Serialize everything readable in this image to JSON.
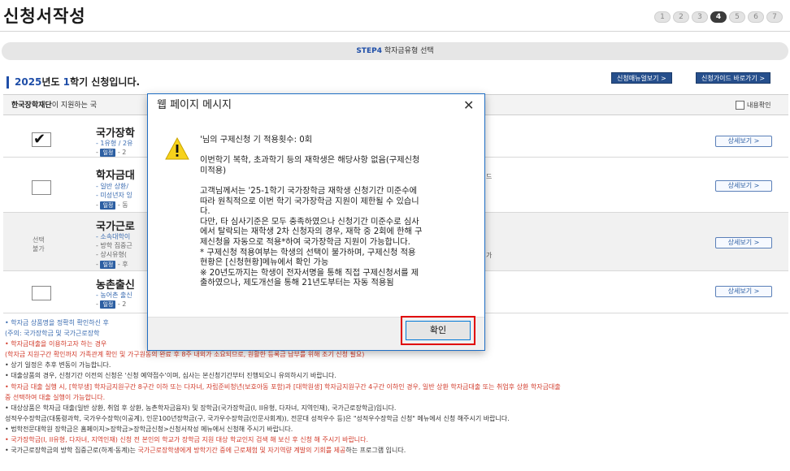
{
  "header": {
    "title": "신청서작성",
    "steps": [
      "1",
      "2",
      "3",
      "4",
      "5",
      "6",
      "7"
    ],
    "active_step": "4"
  },
  "step_bar": {
    "step": "STEP4",
    "text": " 학자금유형 선택"
  },
  "semester": {
    "year": "2025",
    "suffix": "년도 ",
    "term": "1",
    "rest": "학기 신청입니다."
  },
  "buttons": {
    "manual": "신청매뉴얼보기 >",
    "guide": "신청가이드 바로가기 >"
  },
  "notice": {
    "bold": "한국장학재단",
    "text": "이 지원하는 국",
    "confirm": "내용확인"
  },
  "products": [
    {
      "title": "국가장학",
      "sub1": "- 1유형 / 2유",
      "tag": "일정",
      "sub2": "- 2",
      "state": "checked",
      "detail": "상세보기 >"
    },
    {
      "title": "학자금대",
      "sub1": "- 일반 상환/",
      "sub2": "- 미성년자 잉",
      "tag": "일정",
      "sub3": "- 동",
      "state": "empty",
      "detail": "상세보기 >",
      "cut": "드"
    },
    {
      "title": "국가근로",
      "sub1": "- 소속대학이",
      "sub2": "- 방학 집중근",
      "sub3": "- 상시유형(",
      "tag": "일정",
      "sub4": "- 후",
      "state": "disabled",
      "disabled_label_1": "선택",
      "disabled_label_2": "불가",
      "detail": "상세보기 >",
      "cut": "가"
    },
    {
      "title": "농촌출신",
      "sub1": "- 농어촌 출신",
      "tag": "일정",
      "sub2": "- 2",
      "state": "empty",
      "detail": "상세보기 >"
    }
  ],
  "notes": [
    {
      "cls": "b",
      "text": "• 학자금 상품명을 정확히 확인하신 후"
    },
    {
      "cls": "b",
      "text": "  (주의: 국가장학금 및 국가근로장학"
    },
    {
      "cls": "r",
      "text": "• 학자금대출을 이용하고자 하는 경우"
    },
    {
      "cls": "r",
      "text": "  (학자금 지원구간 확인까지 가족관계 확인 및 가구원동의 완료 후 8주 내외가 소요되므로, 원활한 등록금 납부를 위해 조기 신청 필요)"
    },
    {
      "cls": "k",
      "text": "• 상기 일정은 추후 변동이 가능합니다."
    },
    {
      "cls": "k",
      "text": "• 대출상품의 경우, 신청기간 이전의 신청은 '신청 예약접수'이며, 심사는 본신청기간부터 진행되오니 유의하시기 바랍니다."
    },
    {
      "cls": "r",
      "text": "• 학자금 대출 실행 시, [학부생] 학자금지원구간 8구간 이하 또는 다자녀, 자립준비청년(보호아동 포함)과 [대학원생] 학자금지원구간 4구간 이하인 경우, 일반 상환 학자금대출 또는 취업후 상환 학자금대출"
    },
    {
      "cls": "r",
      "text": "  중 선택하여 대출 실행이 가능합니다."
    },
    {
      "cls": "k",
      "text": "• 대상상품은 학자금 대출(일반 상환, 취업 후 상환, 농촌학자금융자) 및 장학금(국가장학금(I, II유형, 다자녀, 지역인재), 국가근로장학금)입니다."
    },
    {
      "cls": "k",
      "text": "  성적우수장학금(대통령과학, 국가우수장학(이공계), 인문100년장학금(구, 국가우수장학금(인문사회계)), 전문대 성적우수 등)은 \"성적우수장학금 신청\" 메뉴에서 신청 해주시기 바랍니다."
    },
    {
      "cls": "k",
      "text": "• 법학전문대학원 장학금은 홈페이지>장학금>장학금신청>신청서작성 메뉴에서 신청해 주시기 바랍니다."
    },
    {
      "cls": "r",
      "text": "• 국가장학금(I, II유형, 다자녀, 지역인재) 신청 전 본인의 학교가 장학금 지원 대상 학교인지 검색 해 보신 후 신청 해 주시기 바랍니다."
    },
    {
      "cls": "k",
      "text": "• 국가근로장학금의 방학 집중근로(하계·동계)는 "
    },
    {
      "cls": "k",
      "text": ""
    }
  ],
  "notes_last": {
    "red": "국가근로장학생에게 방학기간 중에 근로체험 및 자기역량 계발의 기회를 제공",
    "tail": "하는 프로그램 입니다."
  },
  "dialog": {
    "title": "웹 페이지 메시지",
    "close": "✕",
    "message": "'님의 구제신청 기 적용횟수: 0회\n\n이번학기 복학, 초과학기 등의 재학생은 해당사항 없음(구제신청\n미적용)\n\n고객님께서는 '25-1학기 국가장학금 재학생 신청기간 미준수에\n따라 원칙적으로 이번 학기 국가장학금 지원이 제한될 수 있습니\n다.\n다만, 타 심사기준은 모두 충족하였으나 신청기간 미준수로 심사\n에서 탈락되는 재학생 2차 신청자의 경우, 재학 중 2회에 한해 구\n제신청을 자동으로 적용*하여 국가장학금 지원이 가능합니다.\n* 구제신청 적용여부는 학생의 선택이 불가하며, 구제신청 적용\n현황은 [신청현황]메뉴에서 확인 가능\n※ 20년도까지는 학생이 전자서명을 통해 직접 구제신청서를 제\n출하였으나, 제도개선을 통해 21년도부터는 자동 적용됨",
    "ok": "확인"
  }
}
